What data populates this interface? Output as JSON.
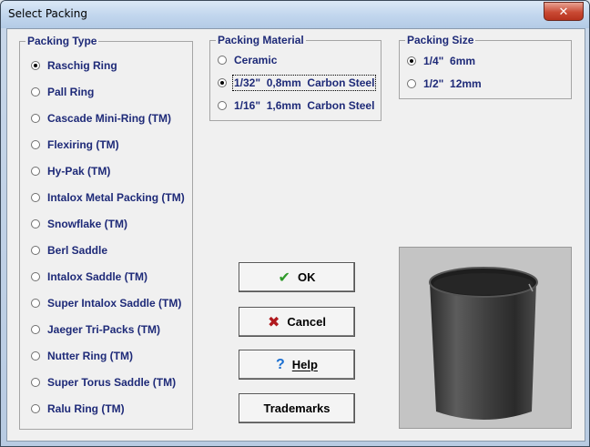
{
  "window": {
    "title": "Select Packing",
    "close_glyph": "✕"
  },
  "packing_type": {
    "title": "Packing Type",
    "options": [
      {
        "label": "Raschig Ring",
        "selected": true
      },
      {
        "label": "Pall Ring",
        "selected": false
      },
      {
        "label": "Cascade Mini-Ring (TM)",
        "selected": false
      },
      {
        "label": "Flexiring (TM)",
        "selected": false
      },
      {
        "label": "Hy-Pak (TM)",
        "selected": false
      },
      {
        "label": "Intalox Metal Packing (TM)",
        "selected": false
      },
      {
        "label": "Snowflake (TM)",
        "selected": false
      },
      {
        "label": "Berl Saddle",
        "selected": false
      },
      {
        "label": "Intalox Saddle (TM)",
        "selected": false
      },
      {
        "label": "Super Intalox Saddle (TM)",
        "selected": false
      },
      {
        "label": "Jaeger Tri-Packs (TM)",
        "selected": false
      },
      {
        "label": "Nutter Ring (TM)",
        "selected": false
      },
      {
        "label": "Super Torus Saddle (TM)",
        "selected": false
      },
      {
        "label": "Ralu Ring (TM)",
        "selected": false
      }
    ]
  },
  "packing_material": {
    "title": "Packing Material",
    "options": [
      {
        "label": "Ceramic",
        "selected": false
      },
      {
        "label": "1/32\"  0,8mm  Carbon Steel",
        "selected": true
      },
      {
        "label": "1/16\"  1,6mm  Carbon Steel",
        "selected": false
      }
    ]
  },
  "packing_size": {
    "title": "Packing Size",
    "options": [
      {
        "label": "1/4\"  6mm",
        "selected": true
      },
      {
        "label": "1/2\"  12mm",
        "selected": false
      }
    ]
  },
  "buttons": {
    "ok": "OK",
    "cancel": "Cancel",
    "help": "Help",
    "trademarks": "Trademarks"
  },
  "icons": {
    "ok": "check-icon",
    "cancel": "x-icon",
    "help": "question-icon"
  },
  "colors": {
    "label_text": "#1e2a78",
    "ok_green": "#2f9a2a",
    "cancel_red": "#b0191e",
    "help_blue": "#1b6fd1"
  }
}
